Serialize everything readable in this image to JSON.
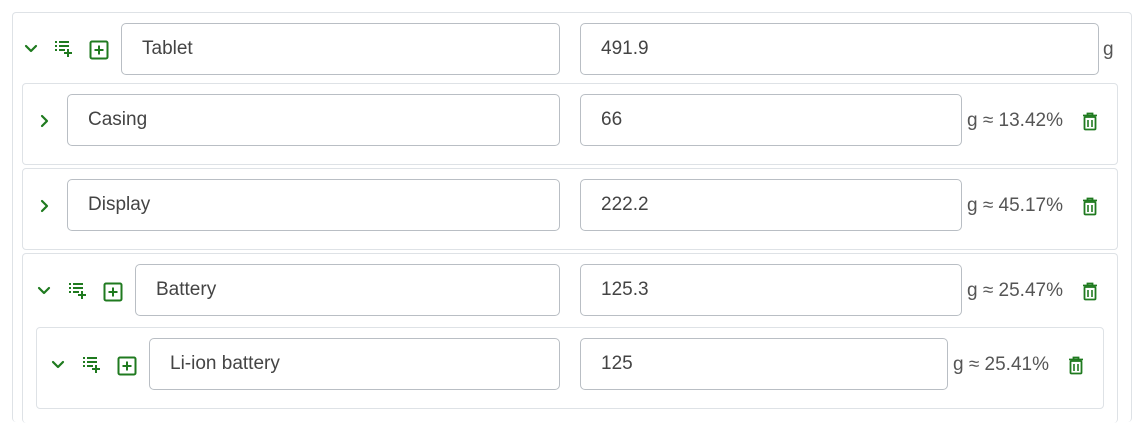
{
  "unit": "g",
  "approx_symbol": "≈",
  "colors": {
    "accent": "#1f7a1f",
    "border": "#dee2e6",
    "field_border": "#b9bec4"
  },
  "root": {
    "name": "Tablet",
    "mass": "491.9",
    "unit_label": "g",
    "expanded": true
  },
  "children": [
    {
      "name": "Casing",
      "mass": "66",
      "share": "g ≈ 13.42%",
      "expanded": false
    },
    {
      "name": "Display",
      "mass": "222.2",
      "share": "g ≈ 45.17%",
      "expanded": false
    },
    {
      "name": "Battery",
      "mass": "125.3",
      "share": "g ≈ 25.47%",
      "expanded": true,
      "children": [
        {
          "name": "Li-ion battery",
          "mass": "125",
          "share": "g ≈ 25.41%",
          "expanded": true
        }
      ]
    }
  ],
  "icons": {
    "expand": "chevron-down-icon",
    "collapse": "chevron-right-icon",
    "add_list": "playlist-add-icon",
    "add": "plus-box-icon",
    "delete": "trash-icon"
  }
}
